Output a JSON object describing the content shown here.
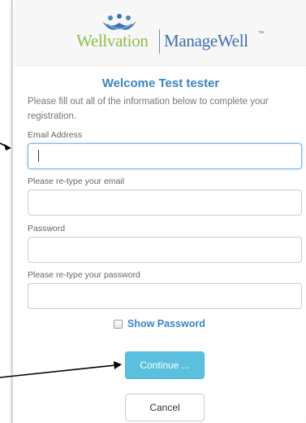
{
  "logo": {
    "brand_left": "Wellvation",
    "brand_right": "ManageWell",
    "trademark": "™"
  },
  "form": {
    "welcome": "Welcome Test tester",
    "instructions": "Please fill out all of the information below to complete your registration.",
    "email_label": "Email Address",
    "email_value": "",
    "confirm_email_label": "Please re-type your email",
    "confirm_email_value": "",
    "password_label": "Password",
    "password_value": "",
    "confirm_password_label": "Please re-type your password",
    "confirm_password_value": "",
    "show_password_label": "Show Password",
    "show_password_checked": false,
    "continue_label": "Continue ...",
    "cancel_label": "Cancel"
  },
  "colors": {
    "accent_blue": "#3a84c8",
    "logo_green": "#8ebd4a",
    "logo_blue": "#3a6fb0",
    "continue_bg": "#5bc0de"
  },
  "annotations": {
    "arrow_icon": "black-pointer-arrow"
  }
}
